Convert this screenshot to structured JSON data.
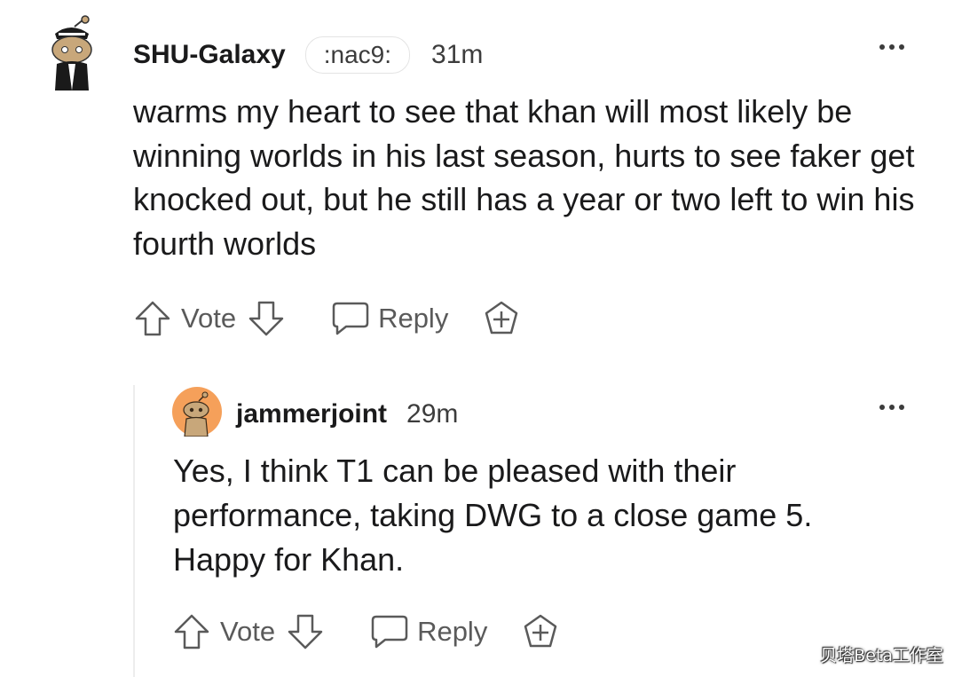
{
  "comments": [
    {
      "username": "SHU-Galaxy",
      "flair": ":nac9:",
      "time": "31m",
      "text": "warms my heart to see that khan will most likely be winning worlds in his last season, hurts to see faker get knocked out, but he still has a year or two left to win his fourth worlds",
      "vote_label": "Vote",
      "reply_label": "Reply"
    },
    {
      "username": "jammerjoint",
      "time": "29m",
      "text": "Yes, I think T1 can be pleased with their performance, taking DWG to a close game 5. Happy for Khan.",
      "vote_label": "Vote",
      "reply_label": "Reply"
    }
  ],
  "watermark": "贝塔Beta工作室",
  "colors": {
    "avatar_bg": "#f5a05a",
    "text": "#1a1a1b",
    "muted": "#5a5a5a"
  },
  "icons": [
    "snoo-avatar-icon",
    "more-options-icon",
    "upvote-icon",
    "downvote-icon",
    "reply-icon",
    "award-icon"
  ]
}
